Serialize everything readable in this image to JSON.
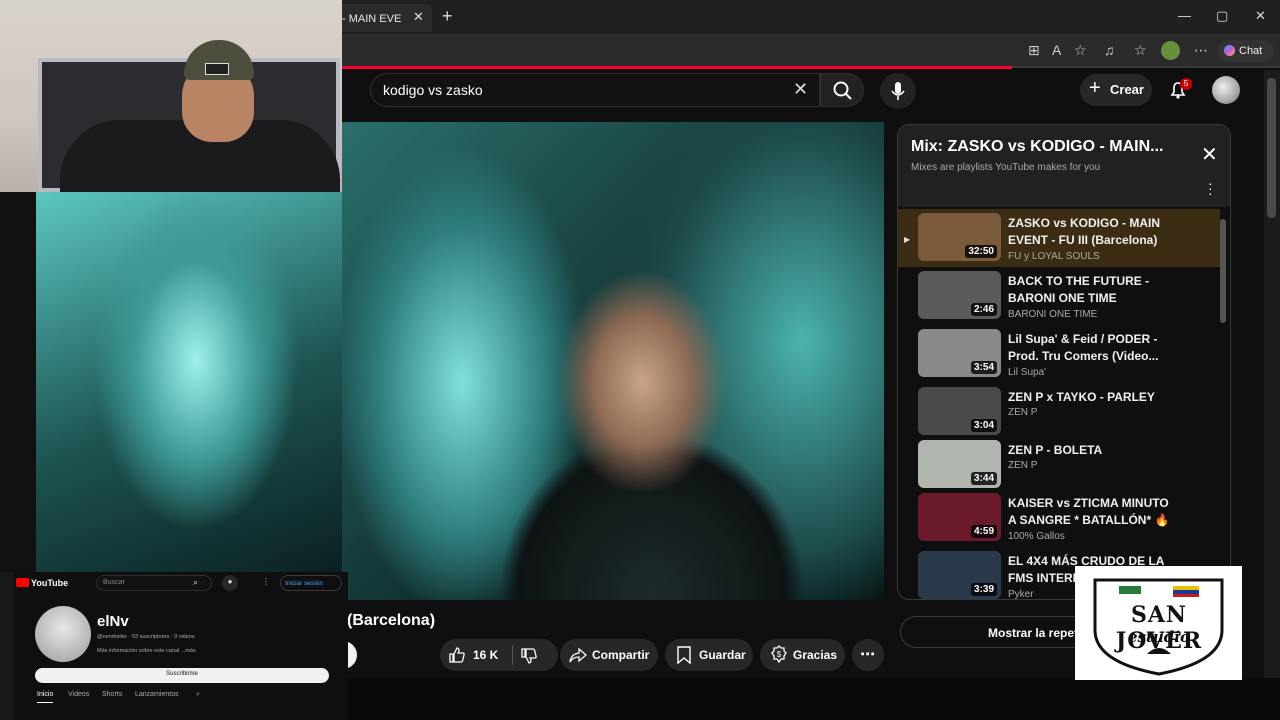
{
  "browser": {
    "tab_title": "- MAIN EVE",
    "chat_label": "Chat"
  },
  "search": {
    "query": "kodigo vs zasko"
  },
  "header": {
    "create_label": "Crear",
    "notifications_count": "5"
  },
  "playlist": {
    "title": "Mix: ZASKO vs KODIGO - MAIN...",
    "subtitle": "Mixes are playlists YouTube makes for you",
    "items": [
      {
        "title": "ZASKO vs KODIGO - MAIN EVENT - FU III (Barcelona)",
        "channel": "FU y LOYAL SOULS",
        "duration": "32:50",
        "color": "#7a5a3a"
      },
      {
        "title": "BACK TO THE FUTURE - BARONI ONE TIME",
        "channel": "BARONI ONE TIME",
        "duration": "2:46",
        "color": "#5a5a5a"
      },
      {
        "title": "Lil Supa' & Feid / PODER - Prod. Tru Comers (Video...",
        "channel": "Lil Supa'",
        "duration": "3:54",
        "color": "#8a8a8a"
      },
      {
        "title": "ZEN P x TAYKO - PARLEY",
        "channel": "ZEN P",
        "duration": "3:04",
        "color": "#4a4a4a"
      },
      {
        "title": "ZEN P - BOLETA",
        "channel": "ZEN P",
        "duration": "3:44",
        "color": "#b0b5b0"
      },
      {
        "title": "KAISER vs ZTICMA MINUTO A SANGRE * BATALLÓN* 🔥",
        "channel": "100% Gallos",
        "duration": "4:59",
        "color": "#6a1a2a"
      },
      {
        "title": "EL 4X4 MÁS CRUDO DE LA FMS INTERN",
        "channel": "Pyker",
        "duration": "3:39",
        "color": "#2a3a4a"
      }
    ]
  },
  "video": {
    "title_fragment": "(Barcelona)",
    "likes": "16 K",
    "share_label": "Compartir",
    "save_label": "Guardar",
    "thanks_label": "Gracias",
    "loop_label": "Mostrar la repeti"
  },
  "mini_channel": {
    "logo_text": "YouTube",
    "search_placeholder": "Buscar",
    "login_label": "Iniciar sesión",
    "channel_name": "elNv",
    "stats": "@nervbeiter · 93 suscriptores · 9 videos",
    "about": "Más información sobre este canal ...más",
    "subscribe_label": "Suscribirme",
    "tabs": [
      "Inicio",
      "Videos",
      "Shorts",
      "Lanzamientos"
    ]
  },
  "logo_overlay": {
    "brand": "SAN JOVER",
    "sub": "estudio"
  },
  "colors": {
    "accent_red": "#ff0033",
    "active_row": "#3b2d13",
    "button_bg": "#272727"
  }
}
